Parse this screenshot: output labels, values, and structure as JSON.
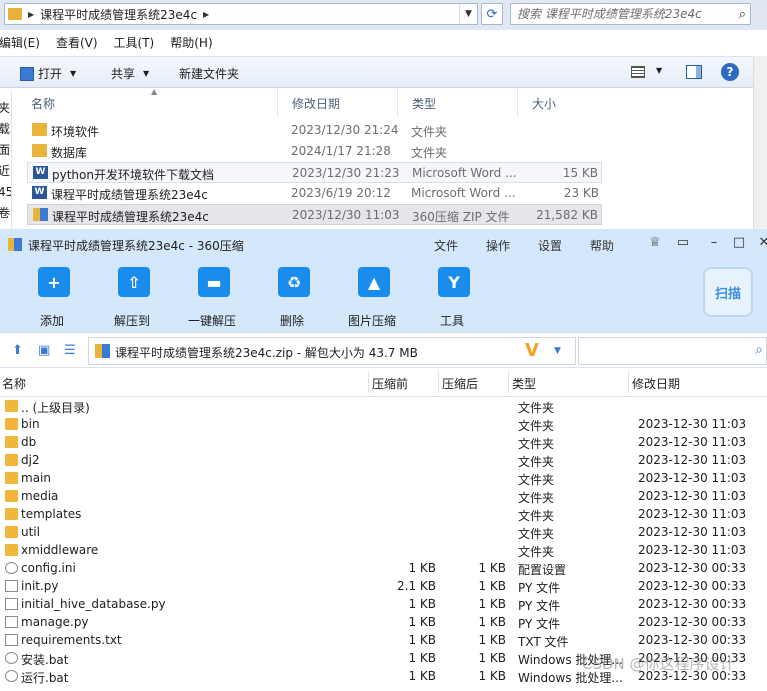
{
  "explorer": {
    "breadcrumb": "课程平时成绩管理系统23e4c",
    "search_placeholder": "搜索 课程平时成绩管理系统23e4c",
    "menu": [
      "编辑(E)",
      "查看(V)",
      "工具(T)",
      "帮助(H)"
    ],
    "toolbar": {
      "open": "打开",
      "share": "共享",
      "new_folder": "新建文件夹"
    },
    "left_nav": [
      "夹",
      "载",
      "面",
      "近",
      "45",
      "卷"
    ],
    "columns": {
      "name": "名称",
      "date": "修改日期",
      "type": "类型",
      "size": "大小"
    },
    "rows": [
      {
        "icon": "folder-icon",
        "name": "环境软件",
        "date": "2023/12/30 21:24",
        "type": "文件夹",
        "size": ""
      },
      {
        "icon": "folder-icon",
        "name": "数据库",
        "date": "2024/1/17 21:28",
        "type": "文件夹",
        "size": ""
      },
      {
        "icon": "word-icon",
        "name": "python开发环境软件下载文档",
        "date": "2023/12/30 21:23",
        "type": "Microsoft Word ...",
        "size": "15 KB"
      },
      {
        "icon": "word-icon",
        "name": "课程平时成绩管理系统23e4c",
        "date": "2023/6/19 20:12",
        "type": "Microsoft Word ...",
        "size": "23 KB"
      },
      {
        "icon": "zip-icon",
        "name": "课程平时成绩管理系统23e4c",
        "date": "2023/12/30 11:03",
        "type": "360压缩 ZIP 文件",
        "size": "21,582 KB"
      }
    ]
  },
  "zip": {
    "title": "课程平时成绩管理系统23e4c - 360压缩",
    "menu": [
      "文件",
      "操作",
      "设置",
      "帮助"
    ],
    "ribbon": [
      {
        "icon": "add-icon",
        "label": "添加"
      },
      {
        "icon": "extract-to-icon",
        "label": "解压到"
      },
      {
        "icon": "one-click-extract-icon",
        "label": "一键解压"
      },
      {
        "icon": "delete-icon",
        "label": "删除"
      },
      {
        "icon": "image-compress-icon",
        "label": "图片压缩"
      },
      {
        "icon": "tools-icon",
        "label": "工具"
      }
    ],
    "scan_label": "扫描",
    "path": "课程平时成绩管理系统23e4c.zip - 解包大小为 43.7 MB",
    "columns": {
      "name": "名称",
      "compressed_before": "压缩前",
      "compressed_after": "压缩后",
      "type": "类型",
      "modified": "修改日期"
    },
    "rows": [
      {
        "icon": "folder-icon",
        "name": ".. (上级目录)",
        "before": "",
        "after": "",
        "type": "文件夹",
        "date": ""
      },
      {
        "icon": "folder-icon",
        "name": "bin",
        "before": "",
        "after": "",
        "type": "文件夹",
        "date": "2023-12-30 11:03"
      },
      {
        "icon": "folder-icon",
        "name": "db",
        "before": "",
        "after": "",
        "type": "文件夹",
        "date": "2023-12-30 11:03"
      },
      {
        "icon": "folder-icon",
        "name": "dj2",
        "before": "",
        "after": "",
        "type": "文件夹",
        "date": "2023-12-30 11:03"
      },
      {
        "icon": "folder-icon",
        "name": "main",
        "before": "",
        "after": "",
        "type": "文件夹",
        "date": "2023-12-30 11:03"
      },
      {
        "icon": "folder-icon",
        "name": "media",
        "before": "",
        "after": "",
        "type": "文件夹",
        "date": "2023-12-30 11:03"
      },
      {
        "icon": "folder-icon",
        "name": "templates",
        "before": "",
        "after": "",
        "type": "文件夹",
        "date": "2023-12-30 11:03"
      },
      {
        "icon": "folder-icon",
        "name": "util",
        "before": "",
        "after": "",
        "type": "文件夹",
        "date": "2023-12-30 11:03"
      },
      {
        "icon": "folder-icon",
        "name": "xmiddleware",
        "before": "",
        "after": "",
        "type": "文件夹",
        "date": "2023-12-30 11:03"
      },
      {
        "icon": "settings-file-icon",
        "name": "config.ini",
        "before": "1 KB",
        "after": "1 KB",
        "type": "配置设置",
        "date": "2023-12-30 00:33"
      },
      {
        "icon": "file-icon",
        "name": "init.py",
        "before": "2.1 KB",
        "after": "1 KB",
        "type": "PY 文件",
        "date": "2023-12-30 00:33"
      },
      {
        "icon": "file-icon",
        "name": "initial_hive_database.py",
        "before": "1 KB",
        "after": "1 KB",
        "type": "PY 文件",
        "date": "2023-12-30 00:33"
      },
      {
        "icon": "file-icon",
        "name": "manage.py",
        "before": "1 KB",
        "after": "1 KB",
        "type": "PY 文件",
        "date": "2023-12-30 00:33"
      },
      {
        "icon": "file-icon",
        "name": "requirements.txt",
        "before": "1 KB",
        "after": "1 KB",
        "type": "TXT 文件",
        "date": "2023-12-30 00:33"
      },
      {
        "icon": "settings-file-icon",
        "name": "安装.bat",
        "before": "1 KB",
        "after": "1 KB",
        "type": "Windows 批处理...",
        "date": "2023-12-30 00:33"
      },
      {
        "icon": "settings-file-icon",
        "name": "运行.bat",
        "before": "1 KB",
        "after": "1 KB",
        "type": "Windows 批处理...",
        "date": "2023-12-30 00:33"
      }
    ]
  },
  "watermark": "CSDN @你这程序设计"
}
